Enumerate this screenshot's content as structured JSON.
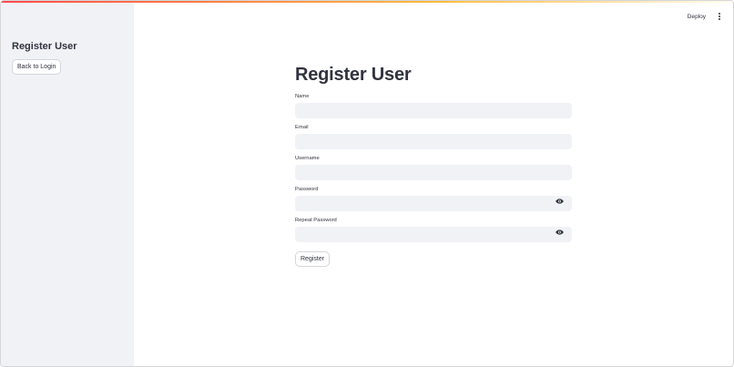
{
  "sidebar": {
    "title": "Register User",
    "back_button_label": "Back to Login"
  },
  "header": {
    "deploy_label": "Deploy",
    "menu_icon": "kebab-menu-icon"
  },
  "main": {
    "title": "Register User",
    "fields": [
      {
        "label": "Name",
        "value": "",
        "type": "text"
      },
      {
        "label": "Email",
        "value": "",
        "type": "text"
      },
      {
        "label": "Username",
        "value": "",
        "type": "text"
      },
      {
        "label": "Password",
        "value": "",
        "type": "password",
        "icon": "eye-icon"
      },
      {
        "label": "Repeat Password",
        "value": "",
        "type": "password",
        "icon": "eye-icon"
      }
    ],
    "submit_label": "Register"
  },
  "colors": {
    "accent": "#ff4b4b",
    "sidebar_bg": "#f0f2f6",
    "input_bg": "#f0f2f6",
    "text": "#31333f"
  }
}
